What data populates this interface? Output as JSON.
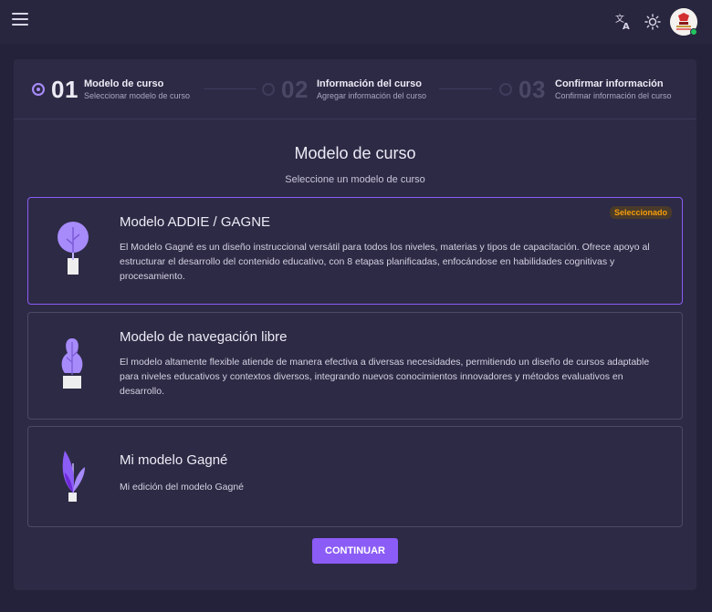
{
  "header": {
    "menu_icon": "menu-icon",
    "translate_icon": "translate-icon",
    "theme_icon": "sun-icon",
    "avatar_icon": "user-avatar"
  },
  "stepper": {
    "steps": [
      {
        "number": "01",
        "title": "Modelo de curso",
        "subtitle": "Seleccionar modelo de curso",
        "active": true
      },
      {
        "number": "02",
        "title": "Información del curso",
        "subtitle": "Agregar información del curso",
        "active": false
      },
      {
        "number": "03",
        "title": "Confirmar información",
        "subtitle": "Confirmar información del curso",
        "active": false
      }
    ]
  },
  "main": {
    "title": "Modelo de curso",
    "subtitle": "Seleccione un modelo de curso",
    "cards": [
      {
        "title": "Modelo ADDIE / GAGNE",
        "description": "El Modelo Gagné es un diseño instruccional versátil para todos los niveles, materias y tipos de capacitación. Ofrece apoyo al estructurar el desarrollo del contenido educativo, con 8 etapas planificadas, enfocándose en habilidades cognitivas y procesamiento.",
        "badge": "Seleccionado",
        "icon": "round-tree-icon",
        "selected": true
      },
      {
        "title": "Modelo de navegación libre",
        "description": "El modelo altamente flexible atiende de manera efectiva a diversas necesidades, permitiendo un diseño de cursos adaptable para niveles educativos y contextos diversos, integrando nuevos conocimientos innovadores y métodos evaluativos en desarrollo.",
        "icon": "potted-plant-icon",
        "selected": false
      },
      {
        "title": "Mi modelo Gagné",
        "description": "Mi edición del modelo Gagné",
        "icon": "leaf-plant-icon",
        "selected": false
      }
    ],
    "continue_label": "CONTINUAR"
  },
  "colors": {
    "accent": "#8b5cf6",
    "badge_text": "#f59e0b",
    "background": "#24223a",
    "panel": "#2d2a45"
  }
}
